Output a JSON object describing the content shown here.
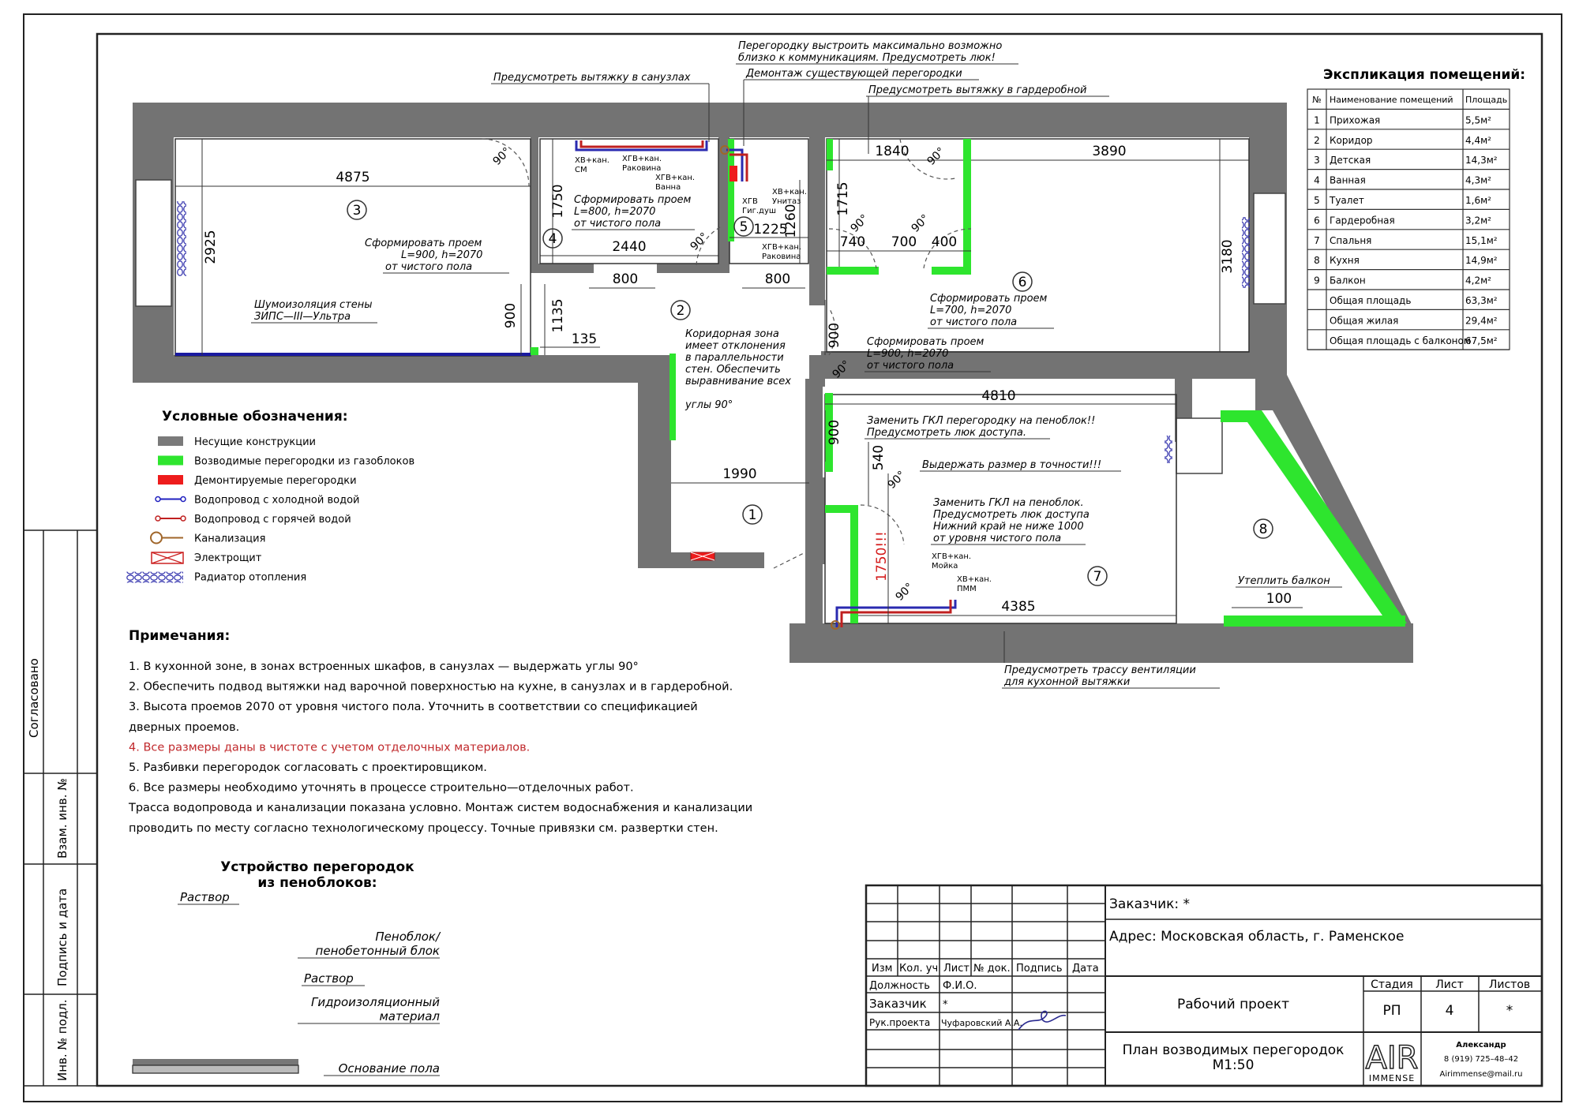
{
  "explication": {
    "title": "Экспликация помещений:",
    "headers": [
      "№",
      "Наименование помещений",
      "Площадь"
    ],
    "rows": [
      [
        "1",
        "Прихожая",
        "5,5м²"
      ],
      [
        "2",
        "Коридор",
        "4,4м²"
      ],
      [
        "3",
        "Детская",
        "14,3м²"
      ],
      [
        "4",
        "Ванная",
        "4,3м²"
      ],
      [
        "5",
        "Туалет",
        "1,6м²"
      ],
      [
        "6",
        "Гардеробная",
        "3,2м²"
      ],
      [
        "7",
        "Спальня",
        "15,1м²"
      ],
      [
        "8",
        "Кухня",
        "14,9м²"
      ],
      [
        "9",
        "Балкон",
        "4,2м²"
      ],
      [
        "",
        "Общая площадь",
        "63,3м²"
      ],
      [
        "",
        "Общая жилая",
        "29,4м²"
      ],
      [
        "",
        "Общая площадь с балконом",
        "67,5м²"
      ]
    ]
  },
  "legend": {
    "title": "Условные обозначения:",
    "items": [
      {
        "label": "Несущие конструкции",
        "kind": "fill",
        "color": "#7a7a7a"
      },
      {
        "label": "Возводимые перегородки из газоблоков",
        "kind": "fill",
        "color": "#2ee52e"
      },
      {
        "label": "Демонтируемые перегородки",
        "kind": "fill",
        "color": "#ee1c1c"
      },
      {
        "label": "Водопровод с холодной водой",
        "kind": "pipe",
        "color": "#2020c0"
      },
      {
        "label": "Водопровод с горячей водой",
        "kind": "pipe",
        "color": "#c02020"
      },
      {
        "label": "Канализация",
        "kind": "sewer",
        "color": "#a0662a"
      },
      {
        "label": "Электрощит",
        "kind": "panel",
        "color": "#cc2222"
      },
      {
        "label": "Радиатор отопления",
        "kind": "radiator",
        "color": "#3a3ab0"
      }
    ]
  },
  "notes": {
    "title": "Примечания:",
    "lines": [
      "1.  В кухонной зоне, в зонах встроенных шкафов, в санузлах — выдержать углы 90°",
      "2.  Обеспечить подвод вытяжки над варочной поверхностью на кухне, в санузлах и в гардеробной.",
      "3.  Высота проемов 2070 от уровня чистого пола. Уточнить в соответствии со спецификацией",
      "     дверных проемов.",
      "4.  Все размеры даны в чистоте с учетом отделочных материалов.",
      "5.  Разбивки перегородок согласовать с проектировщиком.",
      "6.  Все размеры необходимо уточнять в процессе строительно—отделочных работ.",
      "Трасса водопровода и канализации показана условно. Монтаж систем водоснабжения и канализации",
      "проводить по месту согласно технологическому процессу. Точные привязки см. развертки стен."
    ],
    "highlight_color": "#c0282b"
  },
  "wall_section": {
    "title_line1": "Устройство перегородок",
    "title_line2": "из пеноблоков:",
    "label1": "Раствор",
    "label2a": "Пеноблок/",
    "label2b": "пенобетонный блок",
    "label3": "Раствор",
    "label4a": "Гидроизоляционный",
    "label4b": "материал",
    "label5": "Основание пола"
  },
  "side_stamp": {
    "agreed": "Согласовано",
    "inv_exchange": "Взам. инв. №",
    "sign_date": "Подпись и дата",
    "inv_orig": "Инв. № подл."
  },
  "title_block": {
    "customer": "Заказчик: *",
    "address": "Адрес: Московская область, г. Раменское",
    "cols": [
      "Изм",
      "Кол. уч",
      "Лист",
      "№ док.",
      "Подпись",
      "Дата"
    ],
    "row_position_label": "Должность",
    "row_position_value": "Ф.И.О.",
    "row_customer_label": "Заказчик",
    "row_customer_value": "*",
    "row_head_label": "Рук.проекта",
    "row_head_value": "Чуфаровский А.А.",
    "project_type": "Рабочий проект",
    "stage_header": "Стадия",
    "sheet_header": "Лист",
    "sheets_header": "Листов",
    "stage": "РП",
    "sheet": "4",
    "sheets": "*",
    "drawing_title_line1": "План возводимых перегородок",
    "drawing_title_line2": "М1:50",
    "logo_letters": "AIR",
    "logo_word": "IMMENSE",
    "contact_name": "Александр",
    "contact_phone": "8 (919) 725–48–42",
    "contact_email": "Airimmense@mail.ru"
  },
  "plan": {
    "room_numbers": [
      "1",
      "2",
      "3",
      "4",
      "5",
      "6",
      "7",
      "8"
    ],
    "dims": {
      "d4875": "4875",
      "d2925": "2925",
      "d1750": "1750",
      "d2440": "2440",
      "d800a": "800",
      "d800b": "800",
      "d1260": "1260",
      "d1225": "1225",
      "d1840": "1840",
      "d3890": "3890",
      "d1715": "1715",
      "d740": "740",
      "d700": "700",
      "d400": "400",
      "d3180": "3180",
      "d900a": "900",
      "d1135": "1135",
      "d135": "135",
      "d900b": "900",
      "d900c": "900",
      "d4810": "4810",
      "d1990": "1990",
      "d540": "540",
      "d1750r": "1750!!!",
      "d4385": "4385",
      "d100": "100",
      "a90_1": "90°",
      "a90_2": "90°",
      "a90_3": "90°",
      "a90_4": "90°",
      "a90_5": "90°",
      "a90_6": "90°",
      "a90_7": "90°",
      "a90_8": "90°"
    },
    "notes": {
      "n_top1a": "Перегородку выстроить максимально возможно",
      "n_top1b": "близко к коммуникациям. Предусмотреть люк!",
      "n_top2": "Предусмотреть вытяжку в санузлах",
      "n_top3": "Демонтаж существующей перегородки",
      "n_top4": "Предусмотреть вытяжку в гардеробной",
      "n_open1a": "Сформировать проем",
      "n_open1b": "L=900, h=2070",
      "n_open1c": "от чистого пола",
      "n_noise1": "Шумоизоляция стены",
      "n_noise2": "ЗИПС—III—Ультра",
      "n_open2a": "Сформировать проем",
      "n_open2b": "L=800, h=2070",
      "n_open2c": "от чистого пола",
      "n_corr1": "Коридорная зона",
      "n_corr2": "имеет отклонения",
      "n_corr3": "в параллельности",
      "n_corr4": "стен. Обеспечить",
      "n_corr5": "выравнивание всех",
      "n_corr6": "углы 90°",
      "n_open3a": "Сформировать проем",
      "n_open3b": "L=700, h=2070",
      "n_open3c": "от чистого пола",
      "n_open4a": "Сформировать проем",
      "n_open4b": "L=900, h=2070",
      "n_open4c": "от чистого пола",
      "n_gkl1": "Заменить ГКЛ перегородку на пеноблок!!",
      "n_gkl2": "Предусмотреть люк доступа.",
      "n_exact": "Выдержать размер в точности!!!",
      "n_gkl3": "Заменить ГКЛ на пеноблок.",
      "n_gkl4": "Предусмотреть люк доступа",
      "n_gkl5": "Нижний край не ниже 1000",
      "n_gkl6": "от уровня чистого пола",
      "n_balcony": "Утеплить балкон",
      "n_vent1": "Предусмотреть трассу вентиляции",
      "n_vent2": "для кухонной вытяжки",
      "p_hv_cm_1": "ХВ+кан.",
      "p_hv_cm_2": "СМ",
      "p_hgv_rak_1": "ХГВ+кан.",
      "p_hgv_rak_2": "Раковина",
      "p_hgv_van_1": "ХГВ+кан.",
      "p_hgv_van_2": "Ванна",
      "p_hv_un_1": "ХВ+кан.",
      "p_hv_un_2": "Унитаз",
      "p_hgv_gig_1": "ХГВ",
      "p_hgv_gig_2": "Гиг.душ",
      "p_hgv_rak2_1": "ХГВ+кан.",
      "p_hgv_rak2_2": "Раковина",
      "p_hgv_moika_1": "ХГВ+кан.",
      "p_hgv_moika_2": "Мойка",
      "p_hv_pmm_1": "ХВ+кан.",
      "p_hv_pmm_2": "ПММ"
    }
  }
}
